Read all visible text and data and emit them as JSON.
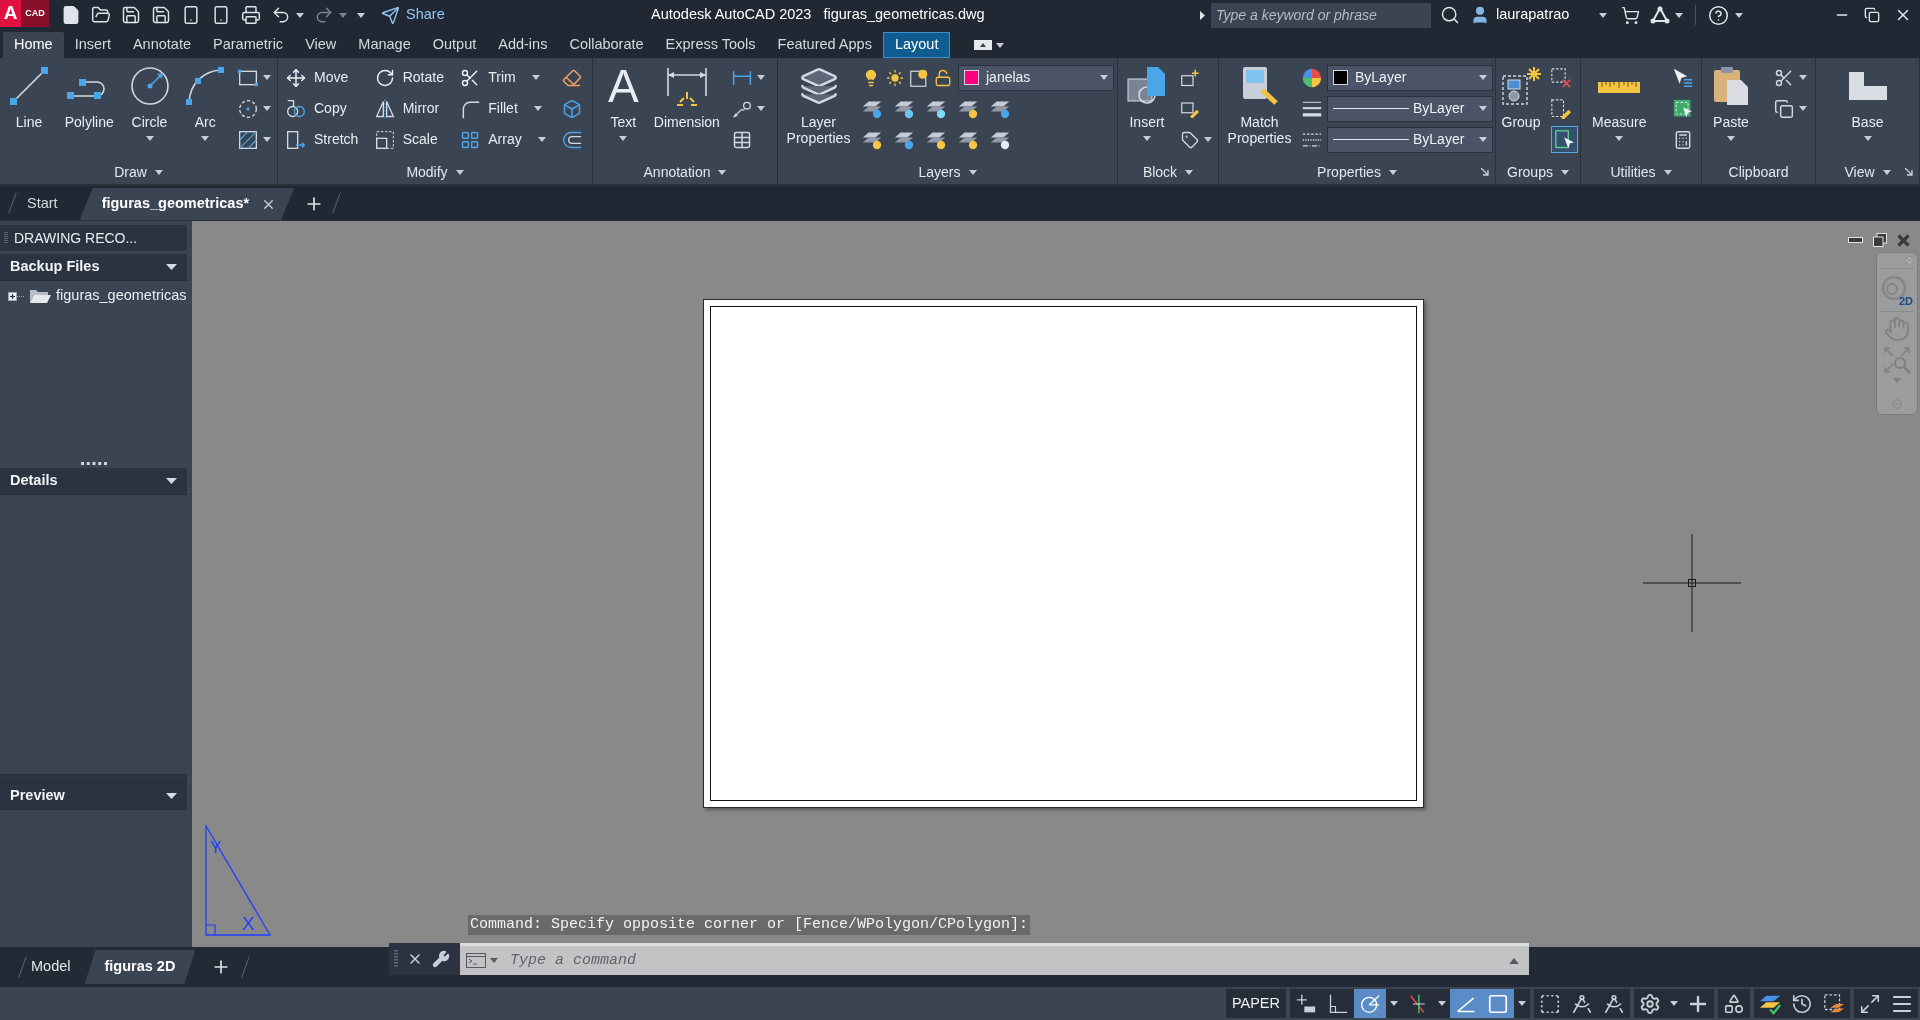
{
  "title_bar": {
    "logo": {
      "letter": "A",
      "label": "CAD"
    },
    "share": "Share",
    "title": "Autodesk AutoCAD 2023",
    "file_name": "figuras_geometricas.dwg",
    "search": {
      "placeholder": "Type a keyword or phrase"
    },
    "user": "laurapatrao"
  },
  "ribbon_tabs": [
    {
      "label": "Home",
      "selected": true,
      "kind": "standard"
    },
    {
      "label": "Insert",
      "selected": false,
      "kind": "standard"
    },
    {
      "label": "Annotate",
      "selected": false,
      "kind": "standard"
    },
    {
      "label": "Parametric",
      "selected": false,
      "kind": "standard"
    },
    {
      "label": "View",
      "selected": false,
      "kind": "standard"
    },
    {
      "label": "Manage",
      "selected": false,
      "kind": "standard"
    },
    {
      "label": "Output",
      "selected": false,
      "kind": "standard"
    },
    {
      "label": "Add-ins",
      "selected": false,
      "kind": "standard"
    },
    {
      "label": "Collaborate",
      "selected": false,
      "kind": "standard"
    },
    {
      "label": "Express Tools",
      "selected": false,
      "kind": "standard"
    },
    {
      "label": "Featured Apps",
      "selected": false,
      "kind": "standard"
    },
    {
      "label": "Layout",
      "selected": false,
      "kind": "contextual"
    }
  ],
  "ribbon_panels": [
    {
      "title": "Draw",
      "menu": true,
      "launcher": false,
      "columns": [
        [
          [
            {
              "kind": "large",
              "label": "Line",
              "dropdown": false
            }
          ]
        ],
        [
          [
            {
              "kind": "large",
              "label": "Polyline",
              "dropdown": false
            }
          ]
        ],
        [
          [
            {
              "kind": "large",
              "label": "Circle",
              "dropdown": true
            }
          ]
        ],
        [
          [
            {
              "kind": "large",
              "label": "Arc",
              "dropdown": true
            }
          ]
        ],
        [
          [
            {
              "kind": "icon",
              "dropdown": true
            }
          ],
          [
            {
              "kind": "icon",
              "dropdown": true
            }
          ],
          [
            {
              "kind": "icon",
              "dropdown": true
            }
          ]
        ]
      ]
    },
    {
      "title": "Modify",
      "menu": true,
      "launcher": false,
      "columns": [
        [
          [
            {
              "kind": "small",
              "label": "Move",
              "dropdown": false
            }
          ],
          [
            {
              "kind": "small",
              "label": "Copy",
              "dropdown": false
            }
          ],
          [
            {
              "kind": "small",
              "label": "Stretch",
              "dropdown": false
            }
          ]
        ],
        [
          [
            {
              "kind": "small",
              "label": "Rotate",
              "dropdown": false
            }
          ],
          [
            {
              "kind": "small",
              "label": "Mirror",
              "dropdown": false
            }
          ],
          [
            {
              "kind": "small",
              "label": "Scale",
              "dropdown": false
            }
          ]
        ],
        [
          [
            {
              "kind": "small",
              "label": "Trim",
              "dropdown": true
            }
          ],
          [
            {
              "kind": "small",
              "label": "Fillet",
              "dropdown": true
            }
          ],
          [
            {
              "kind": "small",
              "label": "Array",
              "dropdown": true
            }
          ]
        ],
        [
          [
            {
              "kind": "icon",
              "dropdown": false
            }
          ],
          [
            {
              "kind": "icon",
              "dropdown": false
            }
          ],
          [
            {
              "kind": "icon",
              "dropdown": false
            }
          ]
        ]
      ]
    },
    {
      "title": "Annotation",
      "menu": true,
      "launcher": false,
      "columns": [
        [
          [
            {
              "kind": "large",
              "label": "Text",
              "glyph": "A",
              "dropdown": true
            }
          ]
        ],
        [
          [
            {
              "kind": "large",
              "label": "Dimension",
              "dropdown": false
            }
          ]
        ],
        [
          [
            {
              "kind": "icon",
              "dropdown": true
            }
          ],
          [
            {
              "kind": "icon",
              "dropdown": true
            }
          ],
          [
            {
              "kind": "icon",
              "dropdown": false
            }
          ]
        ]
      ]
    },
    {
      "title": "Layers",
      "menu": true,
      "launcher": false,
      "columns": [
        [
          [
            {
              "kind": "large",
              "label": "Layer Properties",
              "dropdown": false
            }
          ]
        ],
        [
          [
            {
              "kind": "icon",
              "dropdown": false
            },
            {
              "kind": "icon",
              "dropdown": false
            },
            {
              "kind": "icon",
              "dropdown": false
            },
            {
              "kind": "icon",
              "dropdown": false
            },
            {
              "kind": "combo",
              "value": "janelas",
              "color": "#ff0080"
            }
          ],
          [
            {
              "kind": "icon",
              "dropdown": false
            },
            {
              "kind": "icon",
              "dropdown": false
            },
            {
              "kind": "icon",
              "dropdown": false
            },
            {
              "kind": "icon",
              "dropdown": false
            },
            {
              "kind": "icon",
              "dropdown": false
            }
          ],
          [
            {
              "kind": "icon",
              "dropdown": false
            },
            {
              "kind": "icon",
              "dropdown": false
            },
            {
              "kind": "icon",
              "dropdown": false
            },
            {
              "kind": "icon",
              "dropdown": false
            },
            {
              "kind": "icon",
              "dropdown": false
            }
          ]
        ]
      ]
    },
    {
      "title": "Block",
      "menu": true,
      "launcher": false,
      "columns": [
        [
          [
            {
              "kind": "large",
              "label": "Insert",
              "dropdown": true
            }
          ]
        ],
        [
          [
            {
              "kind": "icon",
              "dropdown": false
            }
          ],
          [
            {
              "kind": "icon",
              "dropdown": false
            }
          ],
          [
            {
              "kind": "icon",
              "dropdown": true
            }
          ]
        ]
      ]
    },
    {
      "title": "Properties",
      "menu": true,
      "launcher": true,
      "columns": [
        [
          [
            {
              "kind": "large",
              "label": "Match Properties",
              "dropdown": false
            }
          ]
        ],
        [
          [
            {
              "kind": "icon",
              "dropdown": false
            },
            {
              "kind": "combo",
              "value": "ByLayer",
              "color": "#000000"
            }
          ],
          [
            {
              "kind": "icon",
              "dropdown": false
            },
            {
              "kind": "line_combo",
              "value": "ByLayer"
            }
          ],
          [
            {
              "kind": "icon",
              "dropdown": false
            },
            {
              "kind": "line_combo",
              "value": "ByLayer"
            }
          ]
        ]
      ]
    },
    {
      "title": "Groups",
      "menu": true,
      "launcher": false,
      "columns": [
        [
          [
            {
              "kind": "large",
              "label": "Group",
              "dropdown": false
            }
          ]
        ],
        [
          [
            {
              "kind": "icon",
              "dropdown": false
            }
          ],
          [
            {
              "kind": "icon",
              "dropdown": false
            }
          ],
          [
            {
              "kind": "toggle",
              "on": true
            }
          ]
        ]
      ]
    },
    {
      "title": "Utilities",
      "menu": true,
      "launcher": false,
      "columns": [
        [
          [
            {
              "kind": "large",
              "label": "Measure",
              "dropdown": true
            }
          ]
        ],
        [
          [
            {
              "kind": "icon",
              "dropdown": false
            }
          ],
          [
            {
              "kind": "icon",
              "dropdown": false
            }
          ],
          [
            {
              "kind": "icon",
              "dropdown": false
            }
          ]
        ]
      ]
    },
    {
      "title": "Clipboard",
      "menu": false,
      "launcher": false,
      "columns": [
        [
          [
            {
              "kind": "large",
              "label": "Paste",
              "dropdown": true
            }
          ]
        ],
        [
          [
            {
              "kind": "icon",
              "dropdown": true
            }
          ],
          [
            {
              "kind": "icon",
              "dropdown": true
            }
          ]
        ]
      ]
    },
    {
      "title": "View",
      "menu": true,
      "launcher": true,
      "columns": [
        [
          [
            {
              "kind": "large",
              "label": "Base",
              "dropdown": true
            }
          ]
        ]
      ]
    }
  ],
  "file_tabs": [
    {
      "label": "Start",
      "selected": false,
      "closable": false
    },
    {
      "label": "figuras_geometricas*",
      "selected": true,
      "closable": true
    }
  ],
  "drawing_recovery": {
    "title": "DRAWING RECO...",
    "sections": [
      {
        "title": "Backup Files",
        "items": [
          {
            "label": "figuras_geometricas",
            "expanded": false
          }
        ]
      },
      {
        "title": "Details"
      },
      {
        "title": "Preview"
      }
    ]
  },
  "viewport": {
    "nav_bar": {
      "wheel_label": "2D"
    },
    "ucs_icon": {
      "x_label": "X",
      "y_label": "Y"
    }
  },
  "command_line": {
    "history": "Command: Specify opposite corner or [Fence/WPolygon/CPolygon]:",
    "placeholder": "Type a command"
  },
  "layout_tabs": [
    {
      "label": "Model",
      "selected": false
    },
    {
      "label": "figuras 2D",
      "selected": true
    }
  ],
  "status_bar": {
    "items": [
      {
        "kind": "label",
        "text": "PAPER"
      },
      {
        "kind": "toggle",
        "on": false,
        "dropdown": false
      },
      {
        "kind": "toggle",
        "on": false,
        "dropdown": false
      },
      {
        "kind": "toggle",
        "on": true,
        "dropdown": true
      },
      {
        "kind": "toggle",
        "on": false,
        "dropdown": true
      },
      {
        "kind": "toggle",
        "on": true,
        "dropdown": false
      },
      {
        "kind": "toggle",
        "on": true,
        "dropdown": true
      },
      {
        "kind": "toggle",
        "on": false,
        "dropdown": false
      },
      {
        "kind": "toggle",
        "on": false,
        "dropdown": false
      },
      {
        "kind": "toggle",
        "on": false,
        "dropdown": false
      },
      {
        "kind": "button",
        "dropdown": true
      },
      {
        "kind": "button",
        "dropdown": false
      },
      {
        "kind": "button",
        "dropdown": false
      },
      {
        "kind": "button",
        "dropdown": false
      },
      {
        "kind": "button",
        "dropdown": false
      },
      {
        "kind": "button",
        "dropdown": false
      },
      {
        "kind": "button",
        "dropdown": false
      },
      {
        "kind": "button",
        "dropdown": false
      }
    ]
  }
}
